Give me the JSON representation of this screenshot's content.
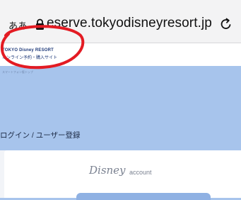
{
  "browser": {
    "text_size_label": "ああ",
    "url": "eserve.tokyodisneyresort.jp"
  },
  "site_header": {
    "logo_main": "TOKYO Disney RESORT",
    "logo_sub": "オンライン予約・購入サイト"
  },
  "breadcrumb": "スマートフォン版トップ",
  "page_title": "ログイン / ユーザー登録",
  "account_logo": {
    "brand": "Disney",
    "word": "account"
  },
  "colors": {
    "page_bg": "#a7c4ec",
    "annotation_circle": "#e31b23"
  }
}
